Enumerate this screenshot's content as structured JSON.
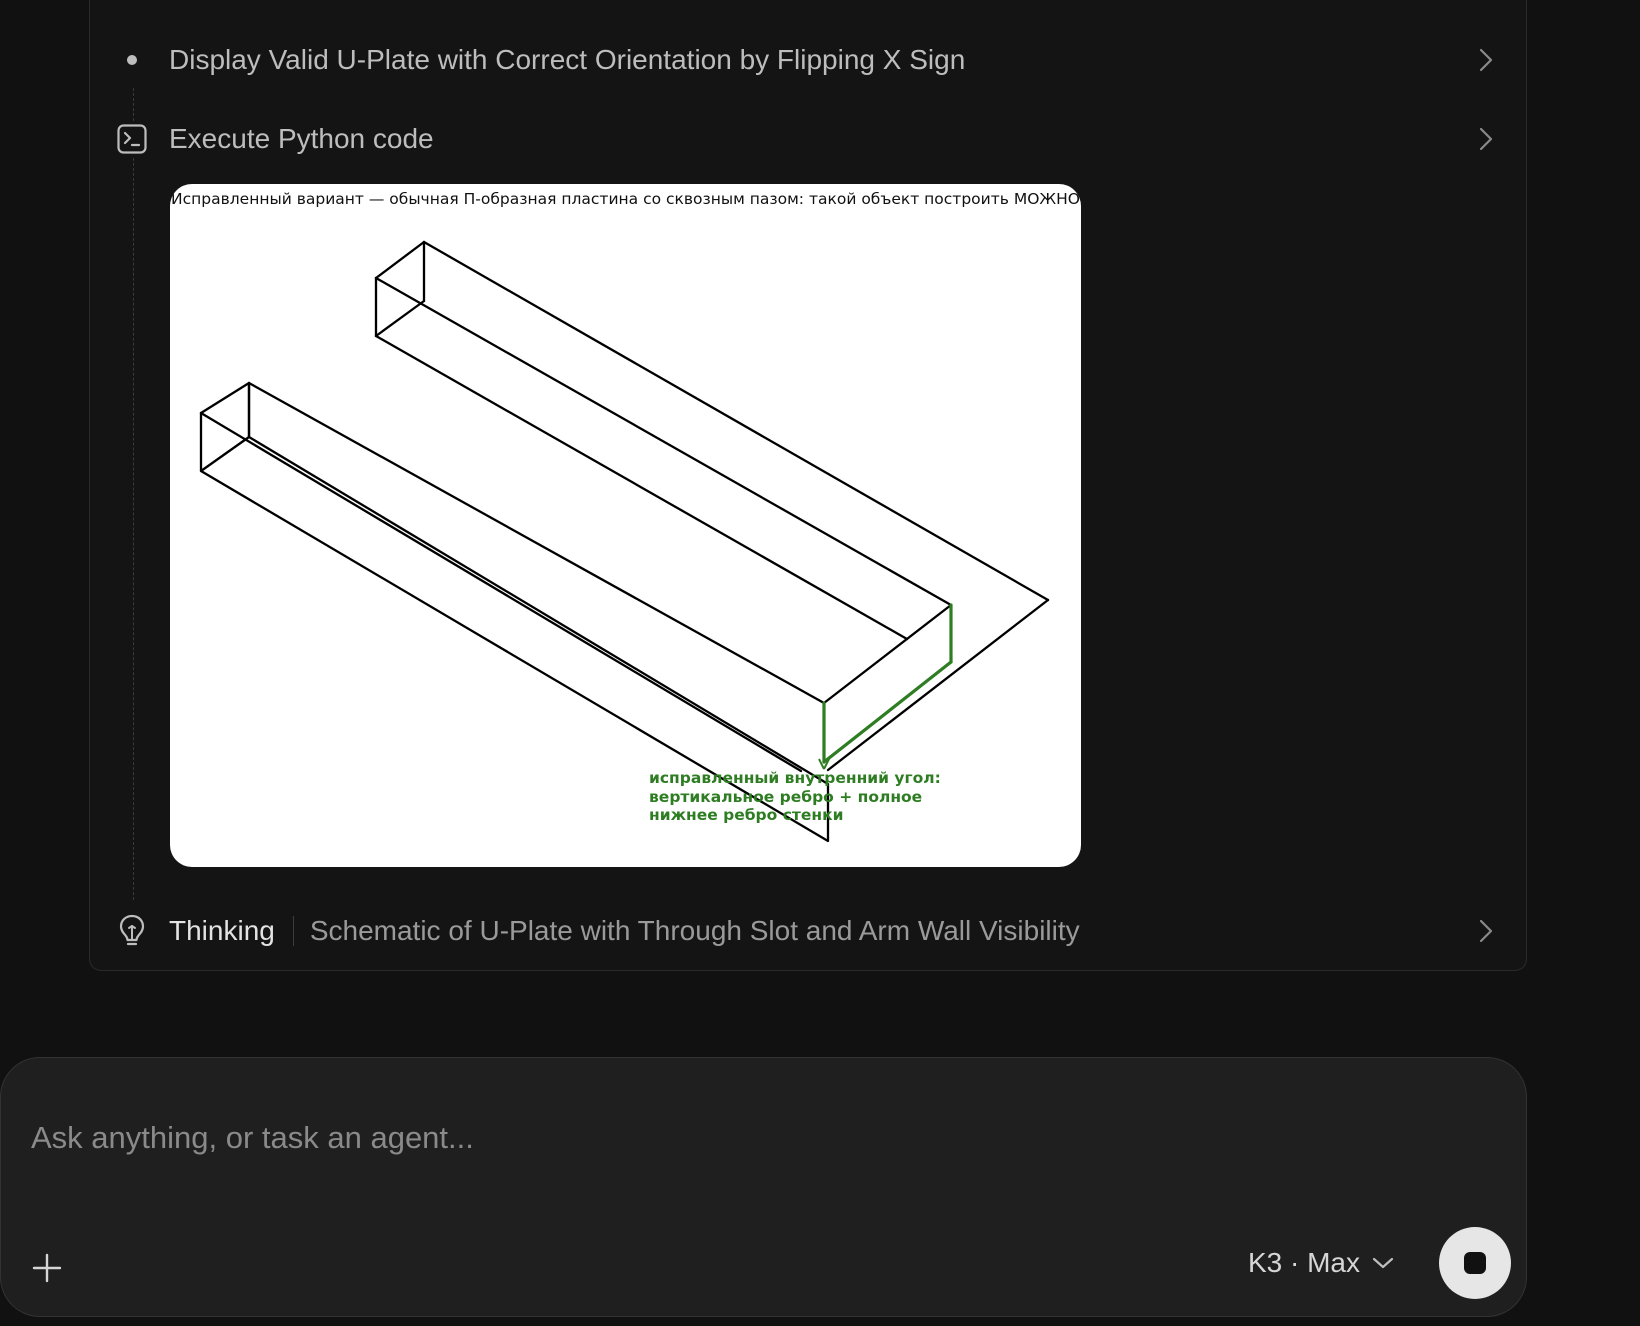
{
  "steps": [
    {
      "label": "Display Valid U-Plate with Correct Orientation by Flipping X Sign",
      "icon": "bullet-dot-icon"
    },
    {
      "label": "Execute Python code",
      "icon": "terminal-icon"
    },
    {
      "label": "Thinking",
      "summary": "Schematic of U-Plate with Through Slot and Arm Wall Visibility",
      "icon": "lightbulb-icon"
    }
  ],
  "figure": {
    "title": "Исправленный вариант — обычная П-образная пластина со сквозным пазом: такой объект построить МОЖНО",
    "annotation_lines": [
      "исправленный внутренний угол:",
      "вертикальное ребро + полное",
      "нижнее ребро стенки"
    ],
    "colors": {
      "edge": "#000000",
      "highlight": "#2e7d23",
      "background": "#ffffff"
    }
  },
  "composer": {
    "placeholder": "Ask anything, or task an agent...",
    "model_label": "K3 · Max",
    "add_icon": "plus-icon",
    "stop_icon": "stop-icon"
  },
  "theme": {
    "background": "#111111",
    "panel": "#141414",
    "composer": "#1f1f1f",
    "stop_button": "#e6e6e6"
  }
}
